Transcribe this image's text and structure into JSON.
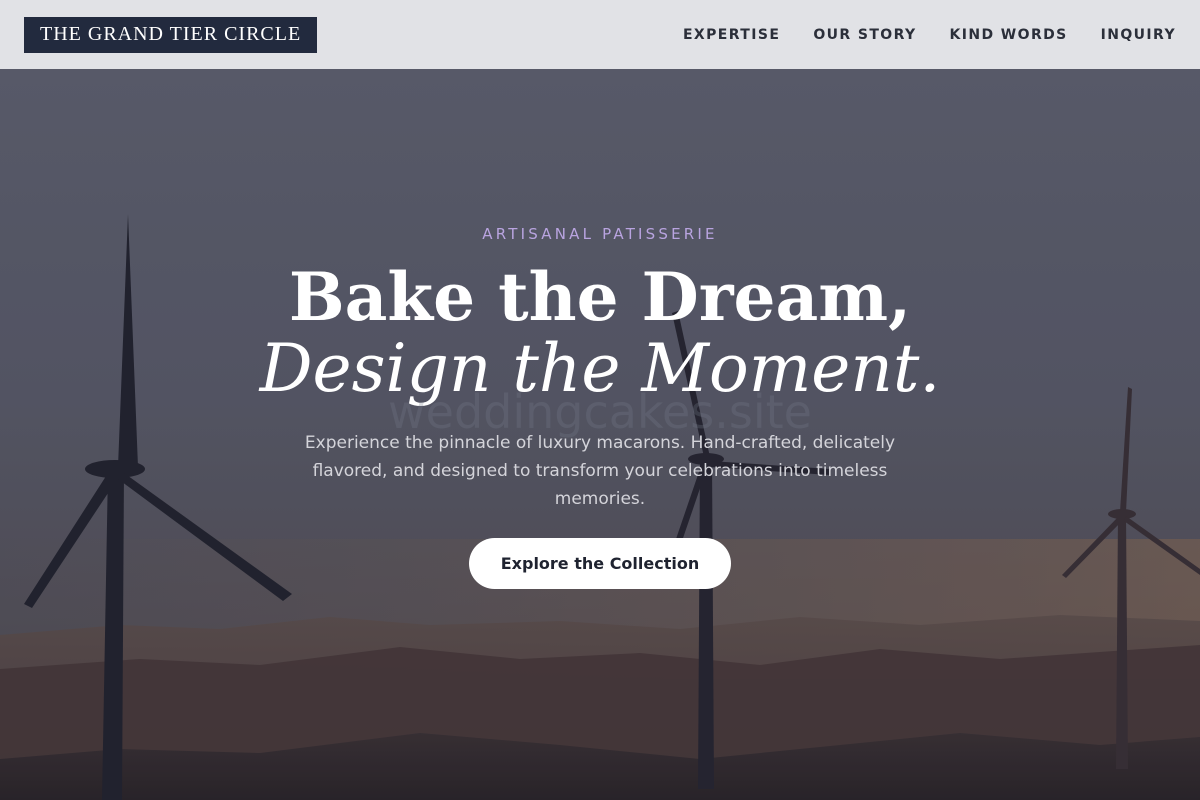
{
  "brand": {
    "name": "THE GRAND TIER CIRCLE"
  },
  "nav": {
    "items": [
      {
        "label": "EXPERTISE"
      },
      {
        "label": "OUR STORY"
      },
      {
        "label": "KIND WORDS"
      },
      {
        "label": "INQUIRY"
      }
    ]
  },
  "hero": {
    "eyebrow": "ARTISANAL PATISSERIE",
    "headline_line1": "Bake the Dream,",
    "headline_line2": "Design the Moment.",
    "watermark": "weddingcakes.site",
    "description": "Experience the pinnacle of luxury macarons. Hand-crafted, delicately flavored, and designed to transform your celebrations into timeless memories.",
    "cta_label": "Explore the Collection",
    "background_subject": "wind-turbines-at-dusk-photo"
  },
  "colors": {
    "header_bg": "#e1e2e6",
    "logo_bg": "#222a3e",
    "eyebrow": "#b9a4e0",
    "cta_bg": "#ffffff"
  }
}
